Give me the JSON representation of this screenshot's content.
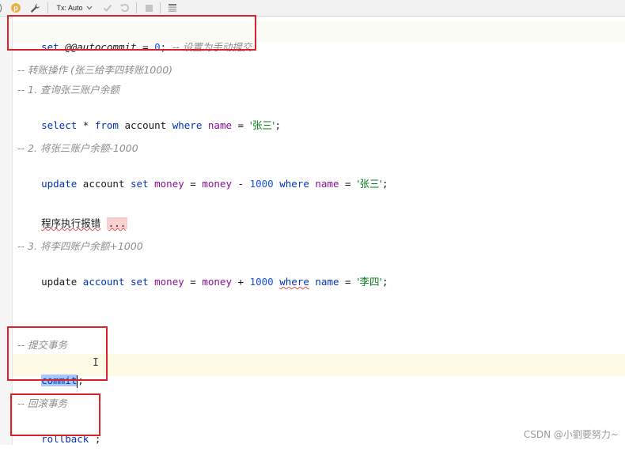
{
  "toolbar": {
    "tx_mode": "Tx: Auto",
    "icons": [
      "profile-badge-icon",
      "wrench-icon",
      "check-icon",
      "undo-icon",
      "stop-icon",
      "output-icon"
    ]
  },
  "code": {
    "line1": {
      "kw_set": "set",
      "var": "@@autocommit",
      "eq": "=",
      "num": "0",
      "semi": ";",
      "comment": "-- 设置为手动提交"
    },
    "comment_transfer": "-- 转账操作 (张三给李四转账1000)",
    "comment_step1": "-- 1. 查询张三账户余额",
    "select_line": {
      "kw_select": "select",
      "star": "*",
      "kw_from": "from",
      "table": "account",
      "kw_where": "where",
      "field": "name",
      "eq": "=",
      "str": "'张三'",
      "semi": ";"
    },
    "comment_step2": "-- 2. 将张三账户余额-1000",
    "update1": {
      "kw_update": "update",
      "table": "account",
      "kw_set": "set",
      "field1": "money",
      "eq": "=",
      "field2": "money",
      "op": "-",
      "num": "1000",
      "kw_where": "where",
      "field3": "name",
      "eq2": "=",
      "str": "'张三'",
      "semi": ";"
    },
    "error_line": {
      "text": "程序执行报错",
      "dots": "..."
    },
    "comment_step3": "-- 3. 将李四账户余额+1000",
    "update2": {
      "kw_update": "update",
      "table": "account",
      "kw_set": "set",
      "field1": "money",
      "eq": "=",
      "field2": "money",
      "op": "+",
      "num": "1000",
      "kw_where": "where",
      "field3": "name",
      "eq2": "=",
      "str": "'李四'",
      "semi": ";"
    },
    "comment_commit": "-- 提交事务",
    "commit_line": {
      "kw": "commit",
      "semi": ";"
    },
    "comment_rollback": "-- 回滚事务",
    "rollback_line": {
      "kw": "rollback",
      "semi": ";"
    }
  },
  "watermark": "CSDN @小劉要努力~",
  "colors": {
    "keyword": "#0033b3",
    "field": "#871094",
    "number": "#1750eb",
    "string": "#067d17",
    "comment": "#8c8c8c",
    "highlight_box": "#d9232a",
    "current_line": "#fdfbe6",
    "selection": "#a6c8ff"
  }
}
